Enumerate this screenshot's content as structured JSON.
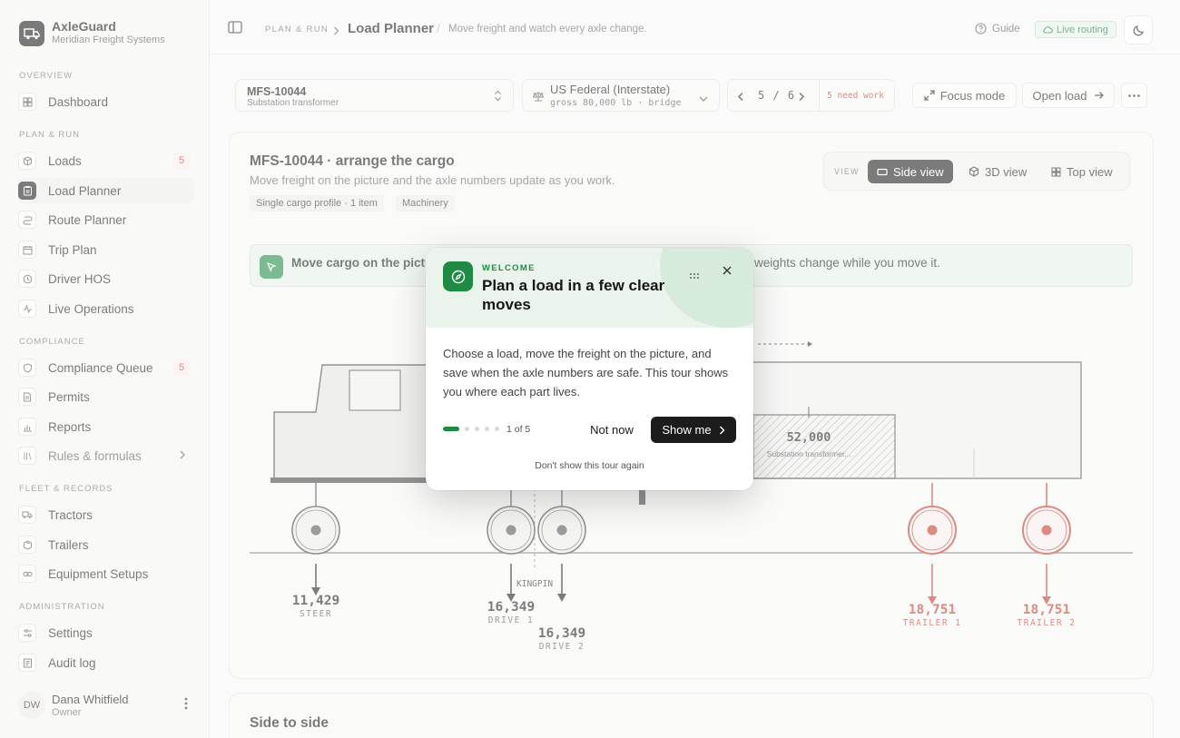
{
  "brand": {
    "name": "AxleGuard",
    "sub": "Meridian Freight Systems"
  },
  "sidebar": {
    "sections": [
      {
        "label": "Overview"
      },
      {
        "label": "Plan & Run"
      },
      {
        "label": "Compliance"
      },
      {
        "label": "Fleet & Records"
      },
      {
        "label": "Administration"
      }
    ],
    "items": [
      {
        "label": "Dashboard"
      },
      {
        "label": "Loads",
        "badge": "5"
      },
      {
        "label": "Load Planner"
      },
      {
        "label": "Route Planner"
      },
      {
        "label": "Trip Plan"
      },
      {
        "label": "Driver HOS"
      },
      {
        "label": "Live Operations"
      },
      {
        "label": "Compliance Queue",
        "badge": "5"
      },
      {
        "label": "Permits"
      },
      {
        "label": "Reports"
      },
      {
        "label": "Rules & formulas"
      },
      {
        "label": "Tractors"
      },
      {
        "label": "Trailers"
      },
      {
        "label": "Equipment Setups"
      },
      {
        "label": "Settings"
      },
      {
        "label": "Audit log"
      }
    ],
    "user": {
      "initials": "DW",
      "name": "Dana Whitfield",
      "role": "Owner"
    }
  },
  "topbar": {
    "crumb_root": "PLAN & RUN",
    "crumb_current": "Load Planner",
    "crumb_slash": "/",
    "crumb_desc": "Move freight and watch every axle change.",
    "guide": "Guide",
    "live": "Live routing"
  },
  "toolbar": {
    "load_id": "MFS-10044",
    "load_desc": "Substation transformer",
    "rule_name": "US Federal (Interstate)",
    "rule_desc": "gross 80,000 lb · bridge",
    "page_count": "5 / 6",
    "need_work": "5 need work",
    "focus_label": "Focus mode",
    "open_label": "Open load"
  },
  "card": {
    "title": "MFS-10044 · arrange the cargo",
    "subtitle": "Move freight on the picture and the axle numbers update as you work.",
    "chips": [
      "Single cargo profile · 1 item",
      "Machinery"
    ],
    "view_label": "VIEW",
    "views": [
      "Side view",
      "3D view",
      "Top view"
    ],
    "banner_bold": "Move cargo on the picture",
    "banner_rest": "weights change while you move it."
  },
  "diagram": {
    "cargo_weight": "52,000",
    "cargo_label": "Substation transformer...",
    "kingpin": "KINGPIN",
    "axles": [
      {
        "value": "11,429",
        "label": "STEER",
        "over": false
      },
      {
        "value": "16,349",
        "label": "DRIVE 1",
        "over": false
      },
      {
        "value": "16,349",
        "label": "DRIVE 2",
        "over": false
      },
      {
        "value": "18,751",
        "label": "TRAILER 1",
        "over": true
      },
      {
        "value": "18,751",
        "label": "TRAILER 2",
        "over": true
      }
    ],
    "colors": {
      "ok": "#1c1c1c",
      "over": "#c0392b"
    }
  },
  "next_card": {
    "title": "Side to side"
  },
  "modal": {
    "eyebrow": "WELCOME",
    "title": "Plan a load in a few clear moves",
    "body": "Choose a load, move the freight on the picture, and save when the axle numbers are safe. This tour shows you where each part lives.",
    "step": "1 of 5",
    "step_progress": 0.2,
    "not_now": "Not now",
    "show_me": "Show me",
    "dont_show": "Don't show this tour again"
  },
  "colors": {
    "accent": "#1e8a44",
    "warning": "#c0392b",
    "ink": "#1c1c1c"
  }
}
